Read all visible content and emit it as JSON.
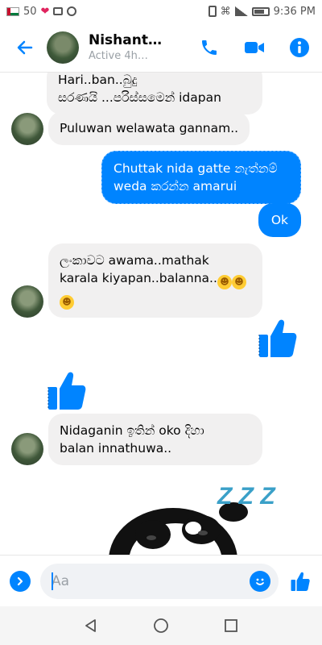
{
  "status_bar": {
    "left_text": "50",
    "time": "9:36 PM"
  },
  "header": {
    "contact_name": "Nishant…",
    "active_status": "Active 4h…"
  },
  "messages": [
    {
      "id": "m1",
      "direction": "in",
      "text_line1": "Hari..ban..බුදු",
      "text_line2": "සරණයි ...පරිස්සමෙන් idapan"
    },
    {
      "id": "m2",
      "direction": "in",
      "text": "Puluwan welawata gannam.."
    },
    {
      "id": "m3",
      "direction": "out",
      "text_line1": "Chuttak nida gatte නැත්නම්",
      "text_line2": "weda කරන්න amarui"
    },
    {
      "id": "m4",
      "direction": "out",
      "text": "Ok"
    },
    {
      "id": "m5",
      "direction": "in",
      "text_line1": "ලංකාවට awama..mathak",
      "text_line2": "karala kiyapan..balanna..",
      "emoji": "rofl"
    },
    {
      "id": "m6",
      "direction": "out",
      "type": "like"
    },
    {
      "id": "m7",
      "direction": "in",
      "type": "like"
    },
    {
      "id": "m8",
      "direction": "in",
      "text_line1": "Nidaganin ඉතින් oko දිහා",
      "text_line2": "balan innathuwa.."
    },
    {
      "id": "m9",
      "direction": "in",
      "type": "sticker",
      "sticker_text": "Z Z Z",
      "icon": "sleeping-panda-sticker"
    }
  ],
  "composer": {
    "placeholder": "Aa"
  },
  "colors": {
    "accent": "#0084ff",
    "incoming_bubble": "#f1f0f0"
  }
}
